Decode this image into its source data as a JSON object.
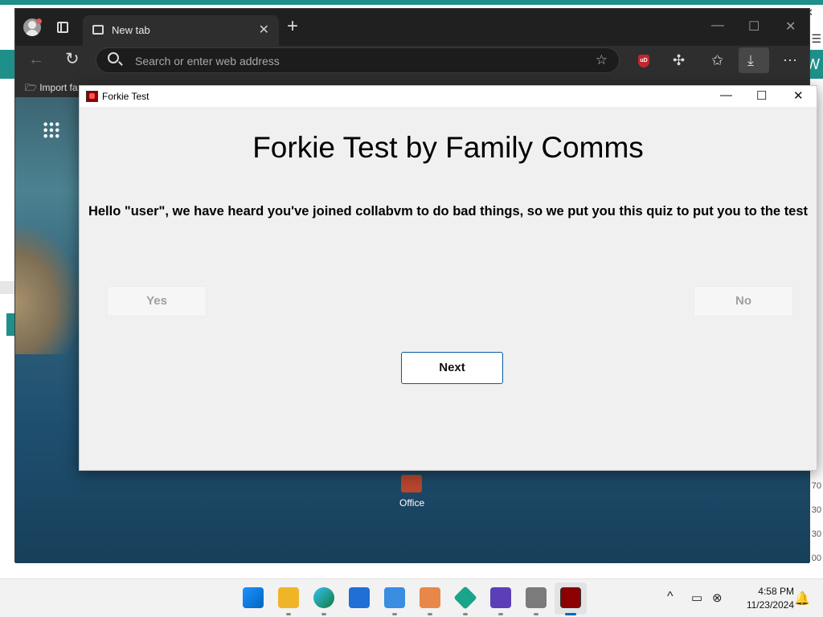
{
  "browser": {
    "tab_title": "New tab",
    "address_placeholder": "Search or enter web address",
    "favorites_label": "Import fa",
    "controls": {
      "minimize": "—",
      "maximize": "☐",
      "close": "✕"
    }
  },
  "ntp": {
    "office_label": "Office"
  },
  "dialog": {
    "title": "Forkie Test",
    "heading": "Forkie Test by Family Comms",
    "message": "Hello \"user\", we have heard you've joined collabvm to do bad things, so we put you this quiz to put you to the test",
    "yes_label": "Yes",
    "no_label": "No",
    "next_label": "Next"
  },
  "taskbar": {
    "time": "4:58 PM",
    "date": "11/23/2024",
    "apps": [
      "start",
      "file-explorer",
      "edge",
      "store",
      "notepad",
      "paint",
      "app-green",
      "app-purple",
      "app-tools",
      "forkie-test"
    ],
    "active_app": "forkie-test"
  },
  "background": {
    "right_numbers": [
      "70",
      "30",
      "30",
      "00"
    ],
    "right_letter": "W"
  },
  "colors": {
    "teal": "#1f8f8a",
    "accent_blue": "#0067c0",
    "dialog_bg": "#f0f0f0"
  }
}
